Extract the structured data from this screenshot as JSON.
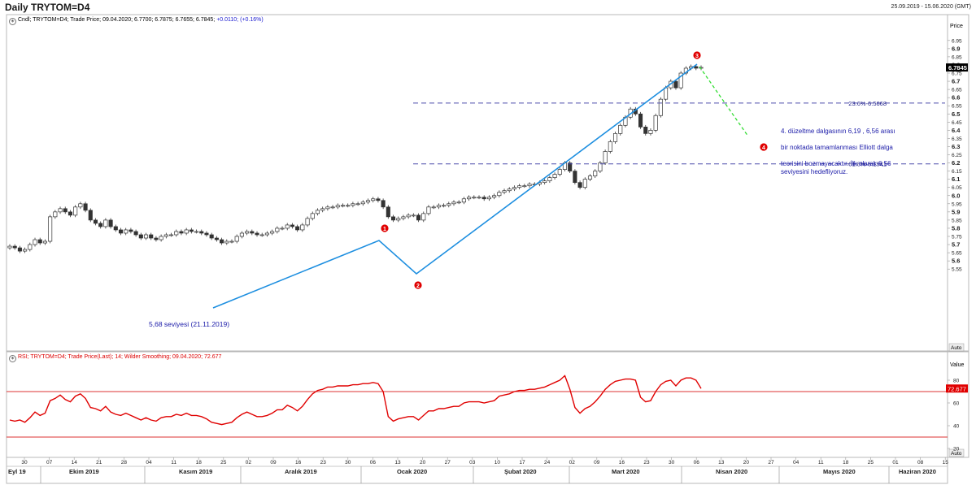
{
  "window": {
    "title": "Daily TRYTOM=D4",
    "date_range": "25.09.2019 - 15.06.2020 (GMT)"
  },
  "price_panel": {
    "legend_prefix": "Cndl; TRYTOM=D4; Trade Price; 09.04.2020; 6.7700; 6.7875; 6.7655; 6.7845;",
    "legend_change": "+0.0110; (+0.16%)",
    "axis_title": "Price",
    "last_price_label": "6.7845",
    "auto_label": "Auto"
  },
  "rsi_panel": {
    "legend": "RSI; TRYTOM=D4; Trade Price(Last); 14; Wilder Smoothing; 09.04.2020; 72.677",
    "axis_title": "Value",
    "last_value_label": "72.677",
    "auto_label": "Auto"
  },
  "annotations": {
    "fib_236": "23.6%-6.5668",
    "fib_618": "61.8%-6.1941",
    "level_note": "5,68 seviyesi  (21.11.2019)",
    "wave_1": "1",
    "wave_2": "2",
    "wave_3": "3",
    "wave_4": "4",
    "comment_line1": "4. düzeltme dalgasının 6,19 , 6,56 arası",
    "comment_line2": "bir noktada tamamlanması Elliott dalga",
    "comment_line3": "teorisini bozmayacaktır. İlk olarak 6,56",
    "comment_line4": "seviyesini hedefliyoruz."
  },
  "colors": {
    "candle": "#333333",
    "rsi": "#e00000",
    "wave_line": "#1e8fe0",
    "projection": "#33dd33",
    "fib_line": "#4444aa",
    "note_text": "#1a1aa8",
    "wave_marker": "#e00000"
  },
  "chart_data": [
    {
      "type": "candlestick",
      "title": "Daily TRYTOM=D4",
      "ylabel": "Price",
      "ylim": [
        5.5,
        6.97
      ],
      "y_ticks": [
        6.95,
        6.9,
        6.85,
        6.8,
        6.75,
        6.7,
        6.65,
        6.6,
        6.55,
        6.5,
        6.45,
        6.4,
        6.35,
        6.3,
        6.25,
        6.2,
        6.15,
        6.1,
        6.05,
        6.0,
        5.95,
        5.9,
        5.85,
        5.8,
        5.75,
        5.7,
        5.65,
        5.6,
        5.55
      ],
      "x_day_labels": [
        "30",
        "07",
        "14",
        "21",
        "28",
        "04",
        "11",
        "18",
        "25",
        "02",
        "09",
        "16",
        "23",
        "30",
        "06",
        "13",
        "20",
        "27",
        "03",
        "10",
        "17",
        "24",
        "02",
        "09",
        "16",
        "23",
        "30",
        "06",
        "13",
        "20",
        "27",
        "04",
        "11",
        "18",
        "25",
        "01",
        "08",
        "15"
      ],
      "x_month_labels": [
        "Eyl 19",
        "Ekim 2019",
        "Kasım 2019",
        "Aralık 2019",
        "Ocak 2020",
        "Şubat 2020",
        "Mart 2020",
        "Nisan 2020",
        "Mayıs 2020",
        "Haziran 2020"
      ],
      "closes": [
        5.69,
        5.68,
        5.66,
        5.67,
        5.7,
        5.73,
        5.71,
        5.72,
        5.87,
        5.9,
        5.92,
        5.9,
        5.88,
        5.93,
        5.95,
        5.91,
        5.85,
        5.83,
        5.81,
        5.85,
        5.81,
        5.79,
        5.77,
        5.79,
        5.78,
        5.76,
        5.74,
        5.76,
        5.74,
        5.73,
        5.75,
        5.76,
        5.76,
        5.78,
        5.77,
        5.79,
        5.78,
        5.78,
        5.77,
        5.76,
        5.74,
        5.73,
        5.71,
        5.72,
        5.72,
        5.75,
        5.77,
        5.78,
        5.77,
        5.76,
        5.76,
        5.77,
        5.78,
        5.8,
        5.8,
        5.82,
        5.81,
        5.79,
        5.82,
        5.86,
        5.89,
        5.91,
        5.92,
        5.93,
        5.93,
        5.94,
        5.94,
        5.94,
        5.95,
        5.95,
        5.96,
        5.97,
        5.98,
        5.97,
        5.93,
        5.87,
        5.85,
        5.86,
        5.87,
        5.88,
        5.88,
        5.85,
        5.89,
        5.93,
        5.93,
        5.94,
        5.94,
        5.95,
        5.96,
        5.96,
        5.98,
        5.99,
        5.99,
        5.99,
        5.98,
        5.99,
        6.0,
        6.02,
        6.03,
        6.04,
        6.05,
        6.06,
        6.06,
        6.07,
        6.07,
        6.08,
        6.09,
        6.11,
        6.13,
        6.16,
        6.2,
        6.15,
        6.08,
        6.05,
        6.1,
        6.12,
        6.15,
        6.2,
        6.27,
        6.33,
        6.38,
        6.43,
        6.48,
        6.53,
        6.5,
        6.42,
        6.38,
        6.4,
        6.49,
        6.59,
        6.66,
        6.7,
        6.66,
        6.75,
        6.78,
        6.79,
        6.78,
        6.785
      ],
      "series_rsi": {
        "ylabel": "Value",
        "ylim": [
          0,
          100
        ],
        "y_ticks": [
          80,
          60,
          40,
          20
        ],
        "reference_lines": [
          70,
          30
        ],
        "values": [
          45,
          44,
          45,
          43,
          47,
          52,
          49,
          51,
          62,
          64,
          67,
          63,
          61,
          66,
          68,
          64,
          56,
          55,
          53,
          57,
          52,
          50,
          49,
          51,
          49,
          47,
          45,
          47,
          45,
          44,
          47,
          48,
          48,
          50,
          49,
          51,
          49,
          49,
          48,
          46,
          43,
          42,
          41,
          42,
          43,
          47,
          50,
          52,
          50,
          48,
          48,
          49,
          51,
          54,
          54,
          58,
          56,
          53,
          57,
          63,
          68,
          71,
          72,
          74,
          74,
          75,
          75,
          75,
          76,
          76,
          77,
          77,
          78,
          77,
          70,
          48,
          44,
          46,
          47,
          48,
          48,
          45,
          49,
          53,
          53,
          55,
          55,
          56,
          57,
          57,
          60,
          61,
          61,
          61,
          60,
          61,
          62,
          66,
          67,
          68,
          70,
          71,
          71,
          72,
          72,
          73,
          74,
          76,
          78,
          80,
          84,
          72,
          56,
          51,
          55,
          57,
          61,
          66,
          72,
          76,
          79,
          80,
          81,
          81,
          80,
          65,
          61,
          62,
          70,
          76,
          79,
          80,
          75,
          80,
          82,
          82,
          80,
          72.677
        ]
      }
    }
  ]
}
